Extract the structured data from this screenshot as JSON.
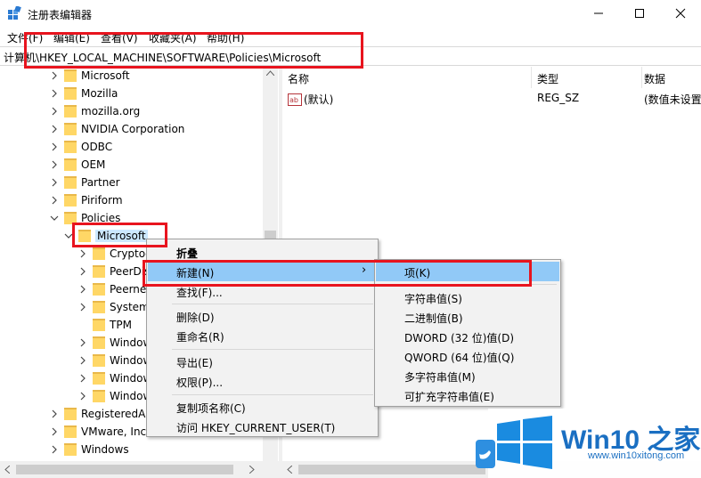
{
  "window": {
    "title": "注册表编辑器",
    "minimize_glyph": "—",
    "maximize_glyph": "☐",
    "close_glyph": "✕"
  },
  "menubar": [
    "文件(F)",
    "编辑(E)",
    "查看(V)",
    "收藏夹(A)",
    "帮助(H)"
  ],
  "address": "计算机\\HKEY_LOCAL_MACHINE\\SOFTWARE\\Policies\\Microsoft",
  "tree": [
    {
      "label": "Microsoft",
      "expanded": false
    },
    {
      "label": "Mozilla",
      "expanded": false
    },
    {
      "label": "mozilla.org",
      "expanded": false
    },
    {
      "label": "NVIDIA Corporation",
      "expanded": false
    },
    {
      "label": "ODBC",
      "expanded": false
    },
    {
      "label": "OEM",
      "expanded": false
    },
    {
      "label": "Partner",
      "expanded": false
    },
    {
      "label": "Piriform",
      "expanded": false
    },
    {
      "label": "Policies",
      "expanded": true
    },
    {
      "label": "Microsoft",
      "expanded": true,
      "selected": true
    },
    {
      "label": "Cryptography",
      "expanded": false
    },
    {
      "label": "PeerDist",
      "expanded": false
    },
    {
      "label": "Peernet",
      "expanded": false
    },
    {
      "label": "SystemCertificates",
      "expanded": false
    },
    {
      "label": "TPM",
      "expanded": null
    },
    {
      "label": "Windows",
      "expanded": false
    },
    {
      "label": "Windows Advanced Threat Protection",
      "expanded": false
    },
    {
      "label": "Windows Defender",
      "expanded": false
    },
    {
      "label": "Windows NT",
      "expanded": false
    },
    {
      "label": "RegisteredApplications",
      "expanded": false
    },
    {
      "label": "VMware, Inc.",
      "expanded": false
    },
    {
      "label": "Windows",
      "expanded": false
    }
  ],
  "list": {
    "columns": [
      "名称",
      "类型",
      "数据"
    ],
    "rows": [
      {
        "name": "(默认)",
        "type": "REG_SZ",
        "data": "(数值未设置)"
      }
    ]
  },
  "context_menu": {
    "items": [
      "折叠",
      "新建(N)",
      "查找(F)...",
      "删除(D)",
      "重命名(R)",
      "导出(E)",
      "权限(P)...",
      "复制项名称(C)",
      "访问 HKEY_CURRENT_USER(T)"
    ],
    "submenu_arrow": "›"
  },
  "submenu": {
    "items": [
      "项(K)",
      "字符串值(S)",
      "二进制值(B)",
      "DWORD (32 位)值(D)",
      "QWORD (64 位)值(Q)",
      "多字符串值(M)",
      "可扩充字符串值(E)"
    ]
  },
  "watermark": {
    "title": "Win10 之家",
    "url": "www.win10xitong.com"
  },
  "colors": {
    "highlight": "#91c9f7",
    "annotation_red": "#e8141e",
    "folder_yellow": "#ffd766",
    "brand_blue": "#1a6fc2"
  }
}
